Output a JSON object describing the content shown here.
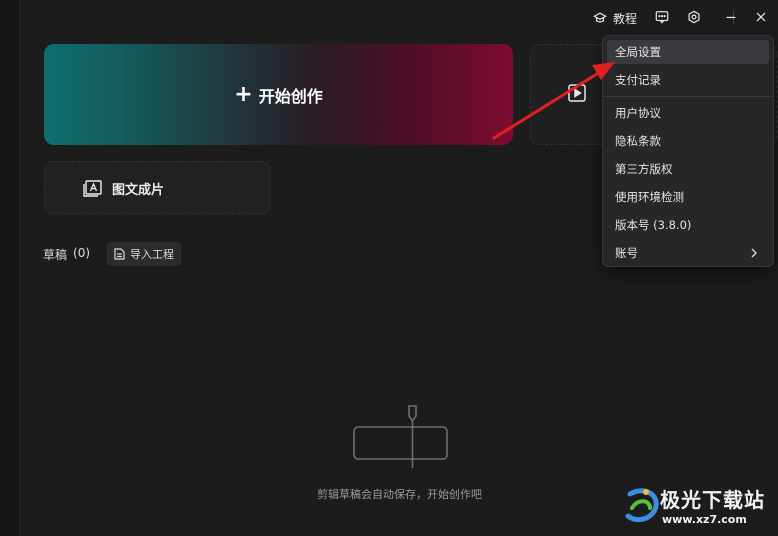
{
  "topbar": {
    "tutorial_label": "教程",
    "icons": [
      "graduation-cap-icon",
      "feedback-icon",
      "settings-icon",
      "minimize-icon",
      "close-icon"
    ]
  },
  "home": {
    "create_label": "开始创作",
    "second_card_label": "",
    "pic_card_label": "图文成片"
  },
  "drafts": {
    "title": "草稿",
    "count": "(0)",
    "import_label": "导入工程",
    "empty_text": "剪辑草稿会自动保存，开始创作吧"
  },
  "menu": {
    "items": [
      {
        "label": "全局设置"
      },
      {
        "label": "支付记录"
      },
      {
        "label": "用户协议"
      },
      {
        "label": "隐私条款"
      },
      {
        "label": "第三方版权"
      },
      {
        "label": "使用环境检测"
      },
      {
        "label": "版本号 (3.8.0)"
      },
      {
        "label": "账号"
      }
    ]
  },
  "watermark": {
    "title": "极光下载站",
    "url": "www.xz7.com"
  },
  "colors": {
    "background": "#1c1c1d",
    "menu_bg": "#27272a",
    "annotation_arrow": "#e0201f",
    "gradient_start": "#0f6f6f",
    "gradient_end": "#7d0b30"
  }
}
